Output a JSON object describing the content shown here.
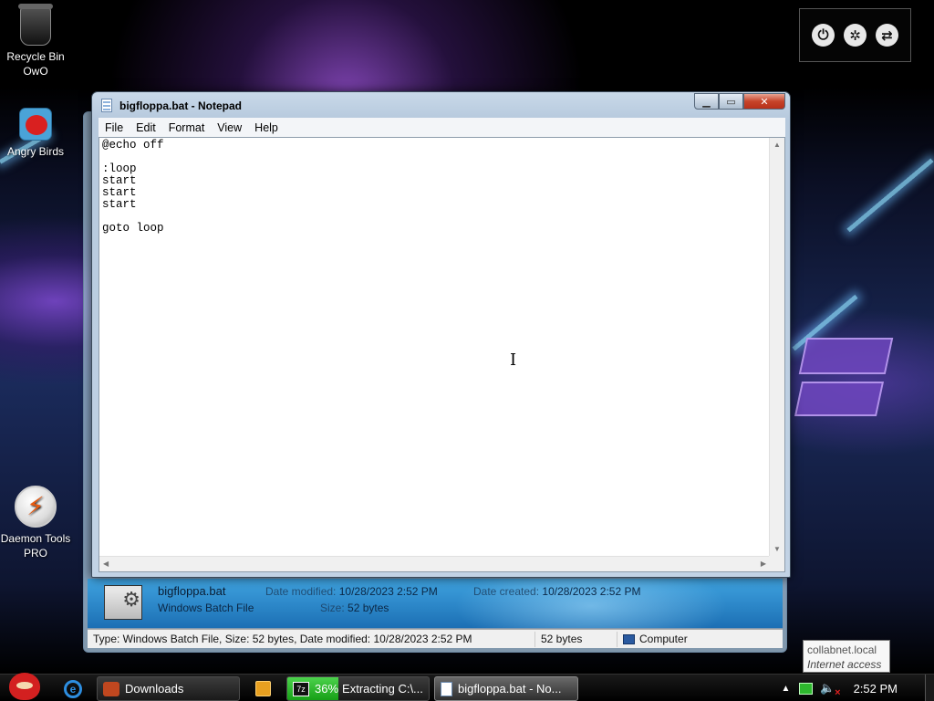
{
  "desktop": {
    "icons": [
      {
        "label": "Recycle Bin OwO",
        "icon": "recycle-bin-icon"
      },
      {
        "label": "Angry Birds",
        "icon": "angry-birds-icon"
      },
      {
        "label": "Daemon Tools PRO",
        "icon": "daemon-tools-icon"
      }
    ],
    "gadget": {
      "buttons": [
        {
          "icon": "power-icon",
          "glyph": "⏻"
        },
        {
          "icon": "asterisk-icon",
          "glyph": "✲"
        },
        {
          "icon": "switch-icon",
          "glyph": "⇄"
        }
      ]
    }
  },
  "notepad": {
    "title": "bigfloppa.bat - Notepad",
    "menu": [
      "File",
      "Edit",
      "Format",
      "View",
      "Help"
    ],
    "content": "@echo off\n\n:loop\nstart\nstart\nstart\n\ngoto loop"
  },
  "explorer": {
    "details": {
      "file_name": "bigfloppa.bat",
      "file_type": "Windows Batch File",
      "date_modified_label": "Date modified:",
      "date_modified": "10/28/2023 2:52 PM",
      "date_created_label": "Date created:",
      "date_created": "10/28/2023 2:52 PM",
      "size_label": "Size:",
      "size": "52 bytes"
    },
    "status": {
      "summary": "Type: Windows Batch File, Size: 52 bytes, Date modified: 10/28/2023 2:52 PM",
      "size": "52 bytes",
      "location": "Computer"
    }
  },
  "tooltip": {
    "line1": "collabnet.local",
    "line2": "Internet access"
  },
  "taskbar": {
    "buttons": [
      {
        "label": "Downloads"
      },
      {
        "label": "Extracting C:\\...",
        "progress_percent": 36,
        "progress_text": "36%"
      },
      {
        "label": "bigfloppa.bat - No..."
      }
    ],
    "clock": "2:52 PM"
  },
  "colors": {
    "progress": "#17a017",
    "close_button": "#c7442a",
    "details_pane": "#1c6fb4"
  }
}
